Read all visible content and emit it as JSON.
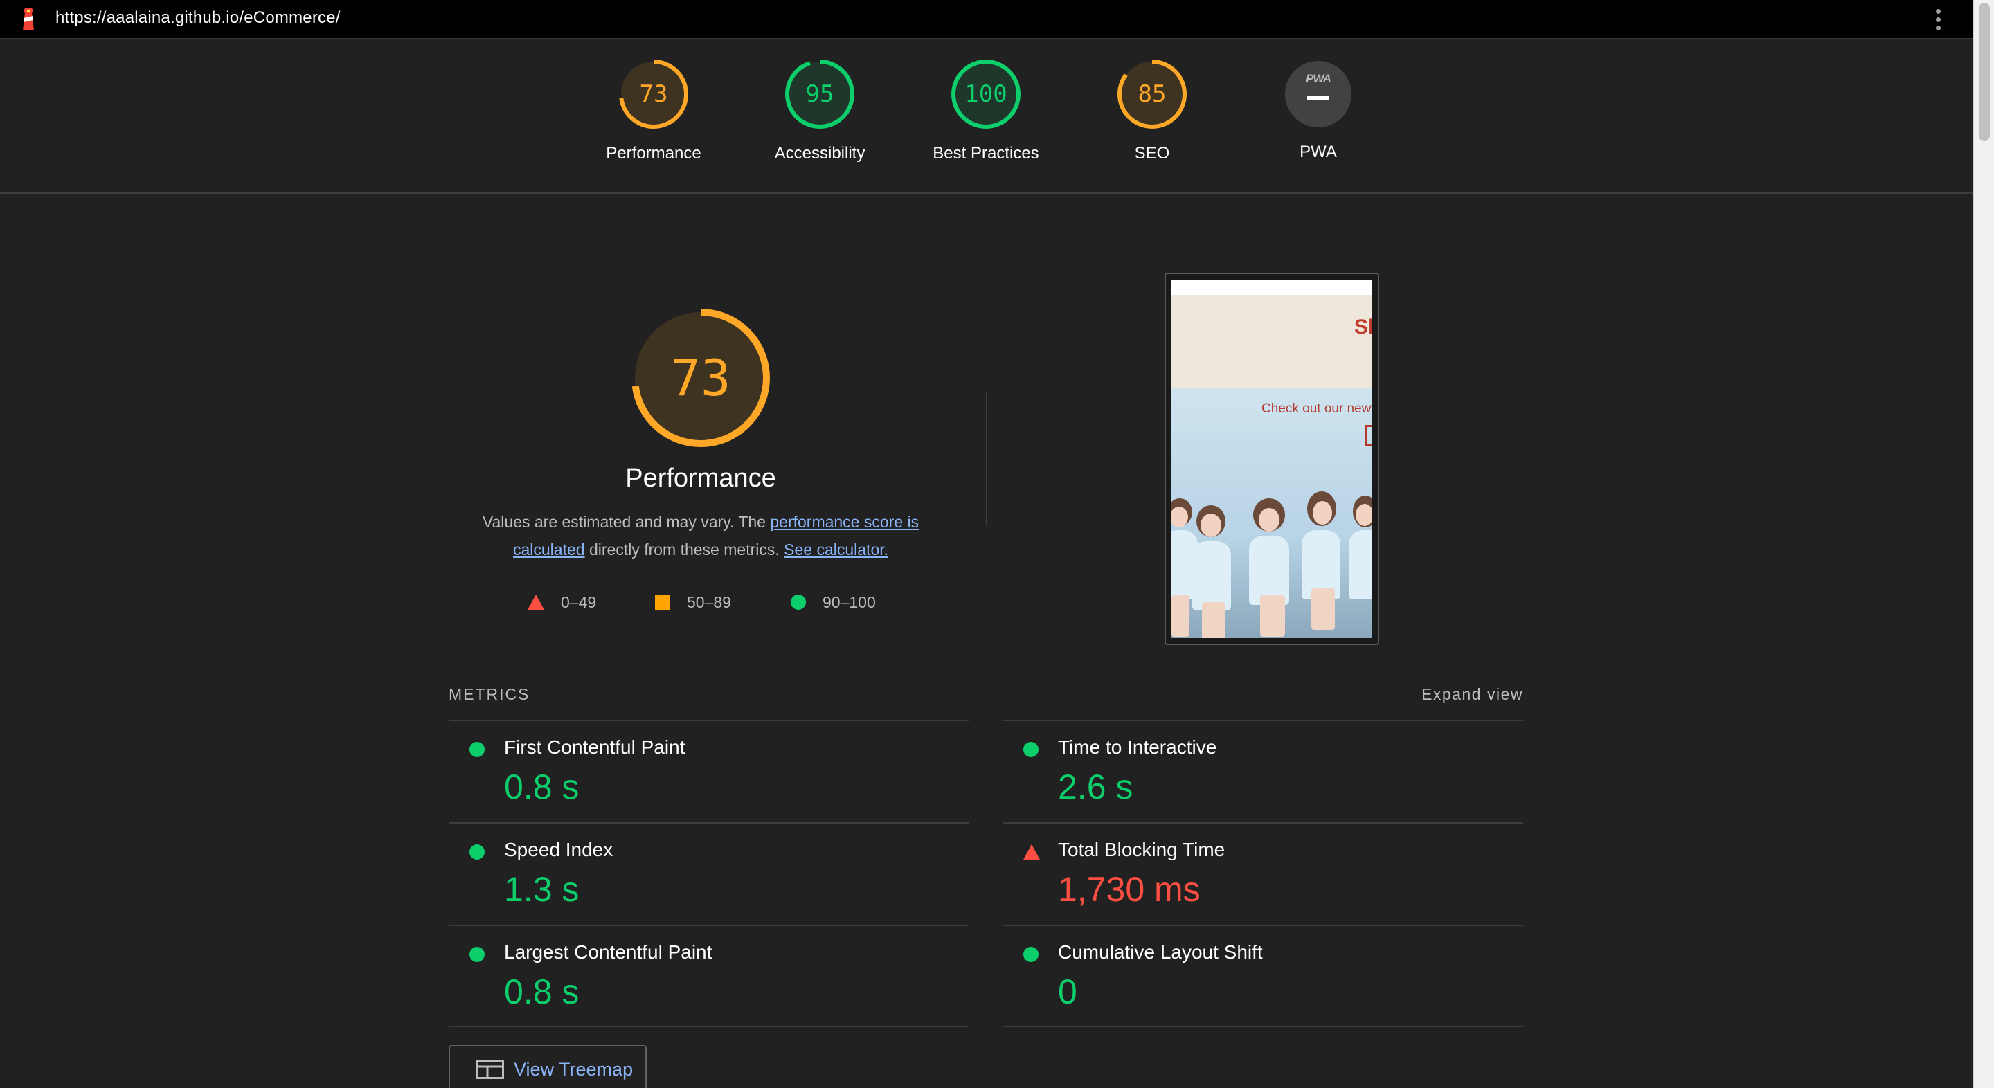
{
  "browser": {
    "url": "https://aaalaina.github.io/eCommerce/",
    "logo_icon": "lighthouse-icon",
    "menu_icon": "kebab-menu-icon"
  },
  "summary": {
    "gauges": [
      {
        "label": "Performance",
        "score": "73",
        "value": 73,
        "color": "#ffa726"
      },
      {
        "label": "Accessibility",
        "score": "95",
        "value": 95,
        "color": "#0cce6b"
      },
      {
        "label": "Best Practices",
        "score": "100",
        "value": 100,
        "color": "#0cce6b"
      },
      {
        "label": "SEO",
        "score": "85",
        "value": 85,
        "color": "#ffa726"
      },
      {
        "label": "PWA",
        "badge_text": "PWA"
      }
    ]
  },
  "performance": {
    "score": "73",
    "value": 73,
    "title": "Performance",
    "desc_prefix": "Values are estimated and may vary. The ",
    "desc_link1": "performance score is calculated",
    "desc_middle": " directly from these metrics. ",
    "desc_link2": "See calculator.",
    "legend": [
      {
        "range": "0–49",
        "shape": "triangle",
        "color": "#ff4e42"
      },
      {
        "range": "50–89",
        "shape": "square",
        "color": "#ffa400"
      },
      {
        "range": "90–100",
        "shape": "circle",
        "color": "#0cce6b"
      }
    ]
  },
  "screenshot": {
    "brand_text": "Sh",
    "banner_text": "Check out our new"
  },
  "metrics": {
    "title": "METRICS",
    "expand_label": "Expand view",
    "items": [
      {
        "name": "First Contentful Paint",
        "value": "0.8 s",
        "status": "pass"
      },
      {
        "name": "Time to Interactive",
        "value": "2.6 s",
        "status": "pass"
      },
      {
        "name": "Speed Index",
        "value": "1.3 s",
        "status": "pass"
      },
      {
        "name": "Total Blocking Time",
        "value": "1,730 ms",
        "status": "fail"
      },
      {
        "name": "Largest Contentful Paint",
        "value": "0.8 s",
        "status": "pass"
      },
      {
        "name": "Cumulative Layout Shift",
        "value": "0",
        "status": "pass"
      }
    ]
  },
  "treemap_button": {
    "label": "View Treemap",
    "icon": "treemap-icon"
  }
}
